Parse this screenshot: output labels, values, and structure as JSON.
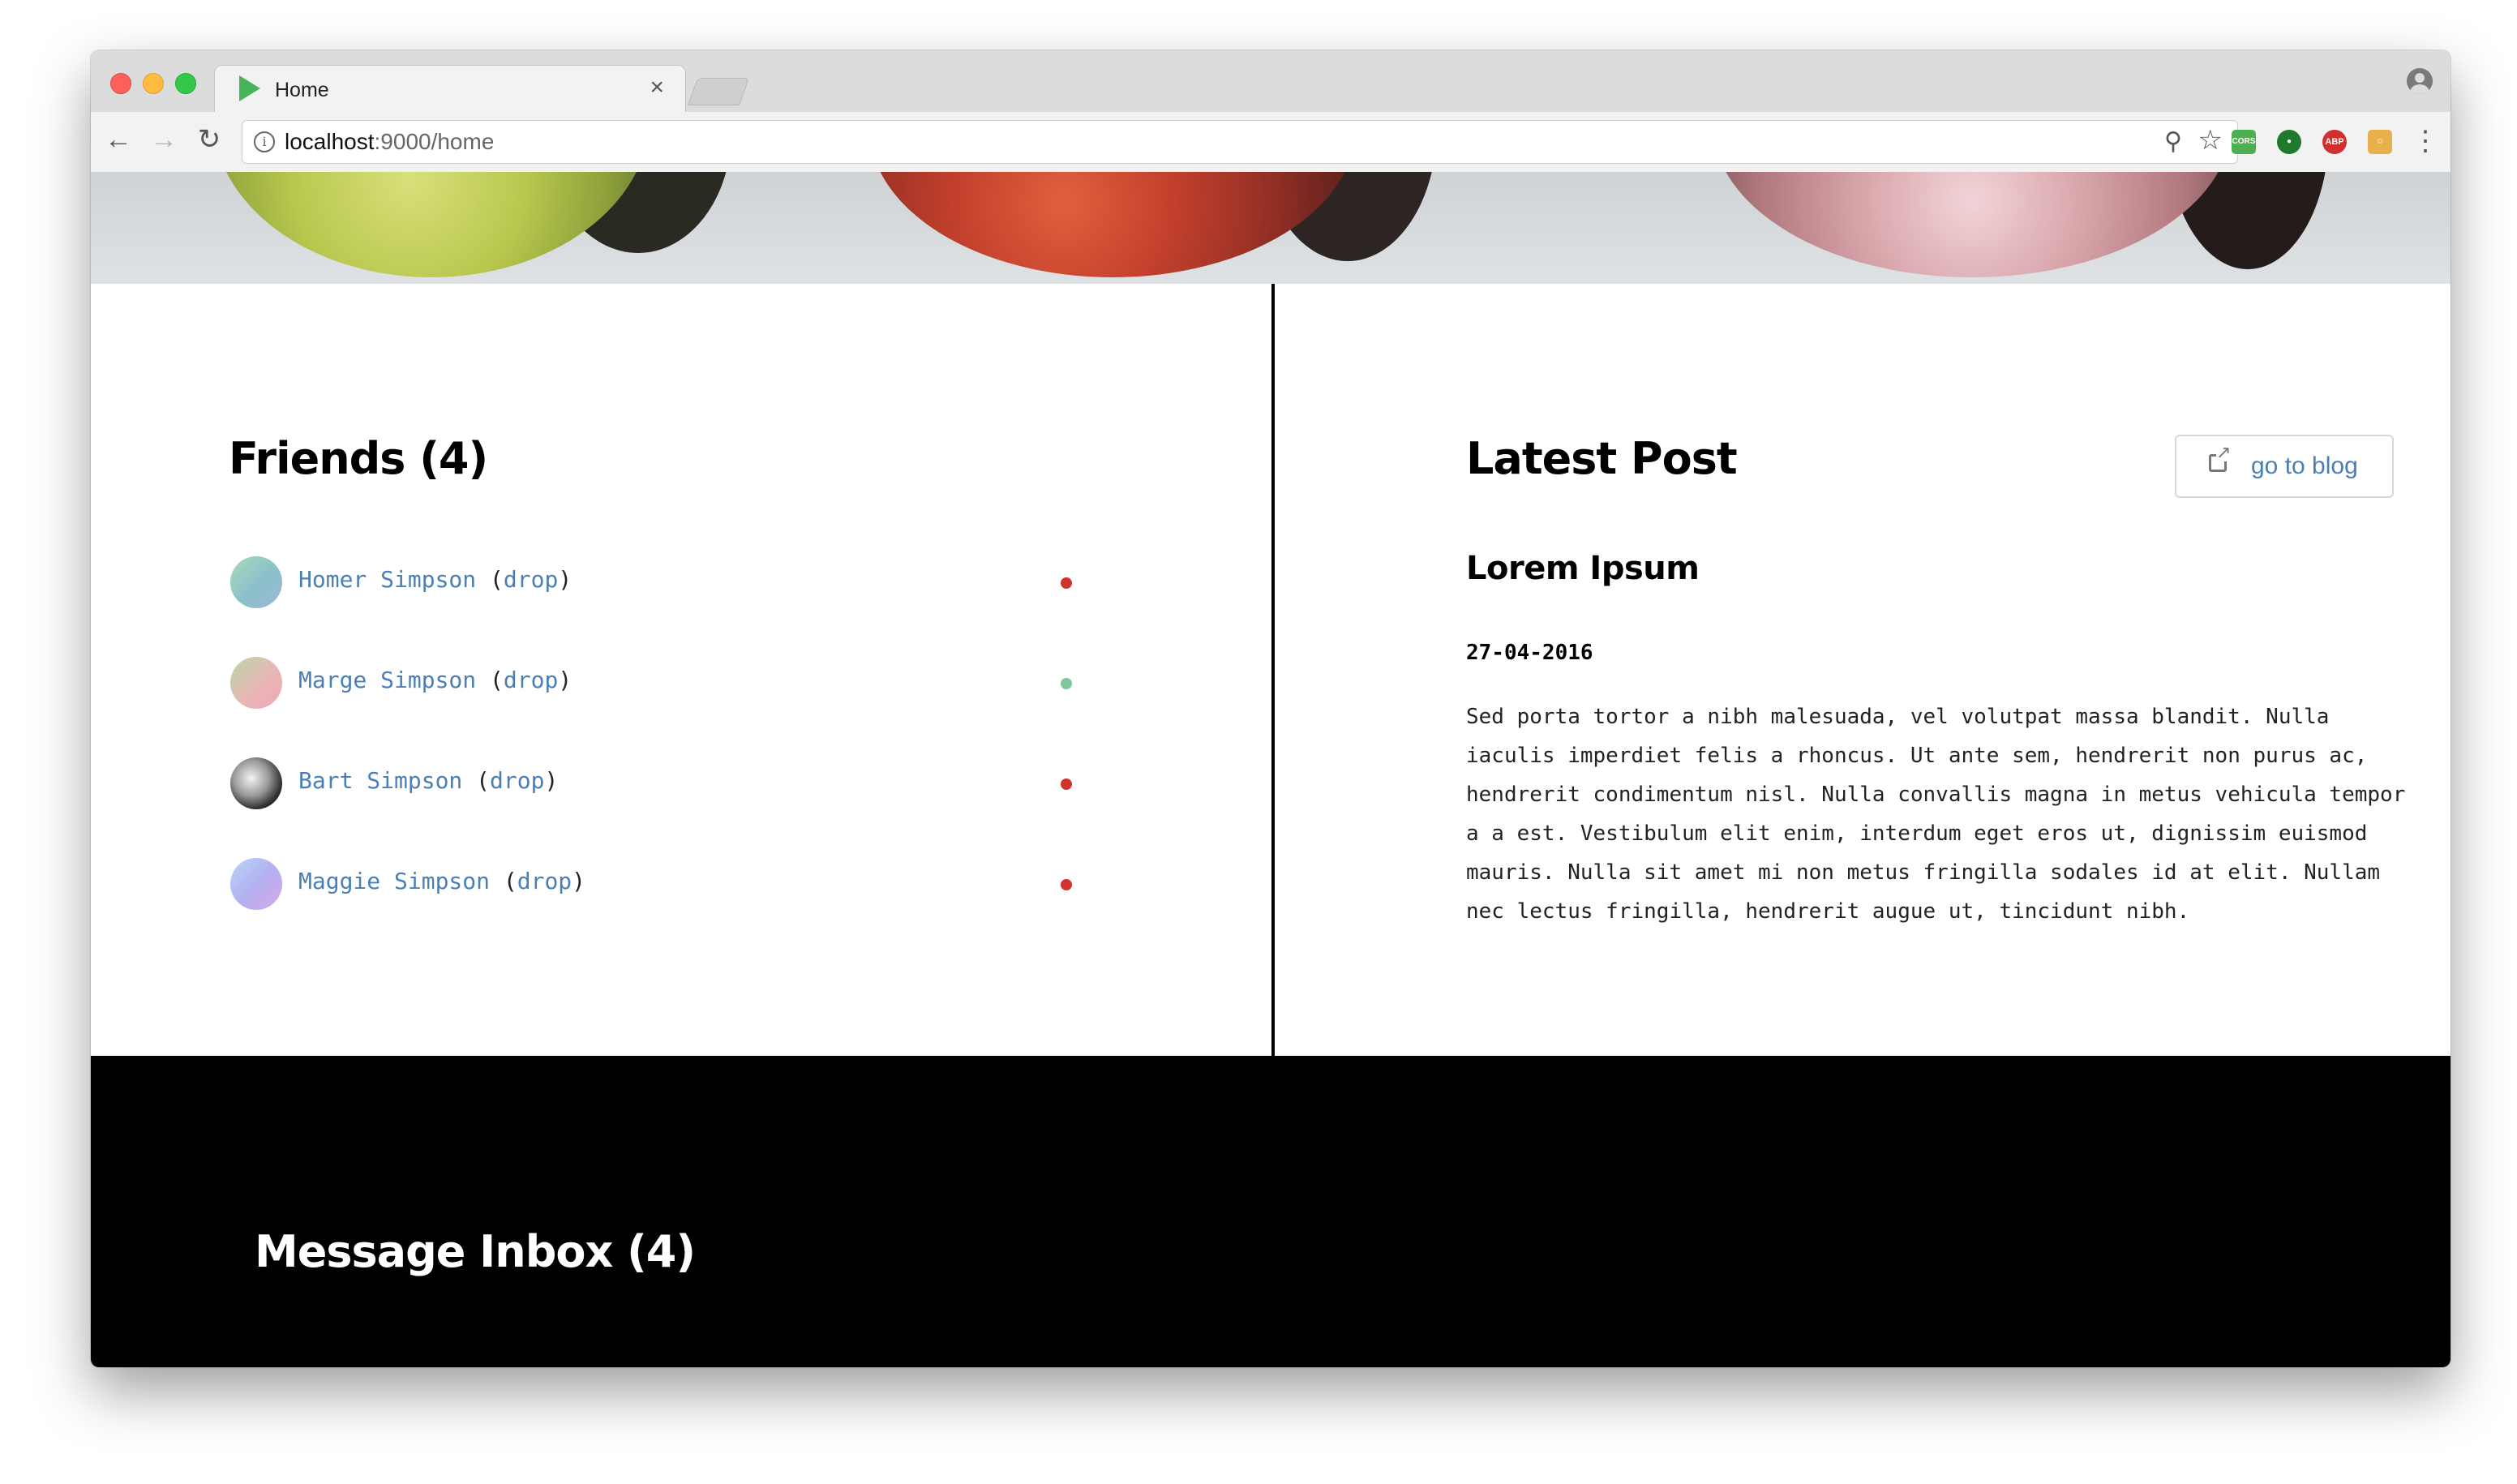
{
  "browser": {
    "tab": {
      "title": "Home",
      "close": "×"
    },
    "url": {
      "host": "localhost",
      "rest": ":9000/home"
    },
    "extensions": {
      "cors": "CORS",
      "abp": "ABP"
    }
  },
  "friends": {
    "title": "Friends (4)",
    "drop_label": "drop",
    "items": [
      {
        "name": "Homer Simpson",
        "status": "offline",
        "status_color": "#d0342c"
      },
      {
        "name": "Marge Simpson",
        "status": "online",
        "status_color": "#7cc89a"
      },
      {
        "name": "Bart Simpson",
        "status": "offline",
        "status_color": "#d0342c"
      },
      {
        "name": "Maggie Simpson",
        "status": "offline",
        "status_color": "#d0342c"
      }
    ]
  },
  "latest_post": {
    "title": "Latest Post",
    "button_label": "go to blog",
    "post": {
      "title": "Lorem Ipsum",
      "date": "27-04-2016",
      "body": "Sed porta tortor a nibh malesuada, vel volutpat massa blandit. Nulla iaculis imperdiet felis a rhoncus. Ut ante sem, hendrerit non purus ac, hendrerit condimentum nisl. Nulla convallis magna in metus vehicula tempor a a est. Vestibulum elit enim, interdum eget eros ut, dignissim euismod mauris. Nulla sit amet mi non metus fringilla sodales id at elit. Nullam nec lectus fringilla, hendrerit augue ut, tincidunt nibh."
    }
  },
  "inbox": {
    "title": "Message Inbox (4)"
  },
  "colors": {
    "link": "#4a7fb6",
    "offline": "#d0342c",
    "online": "#7cc89a"
  }
}
